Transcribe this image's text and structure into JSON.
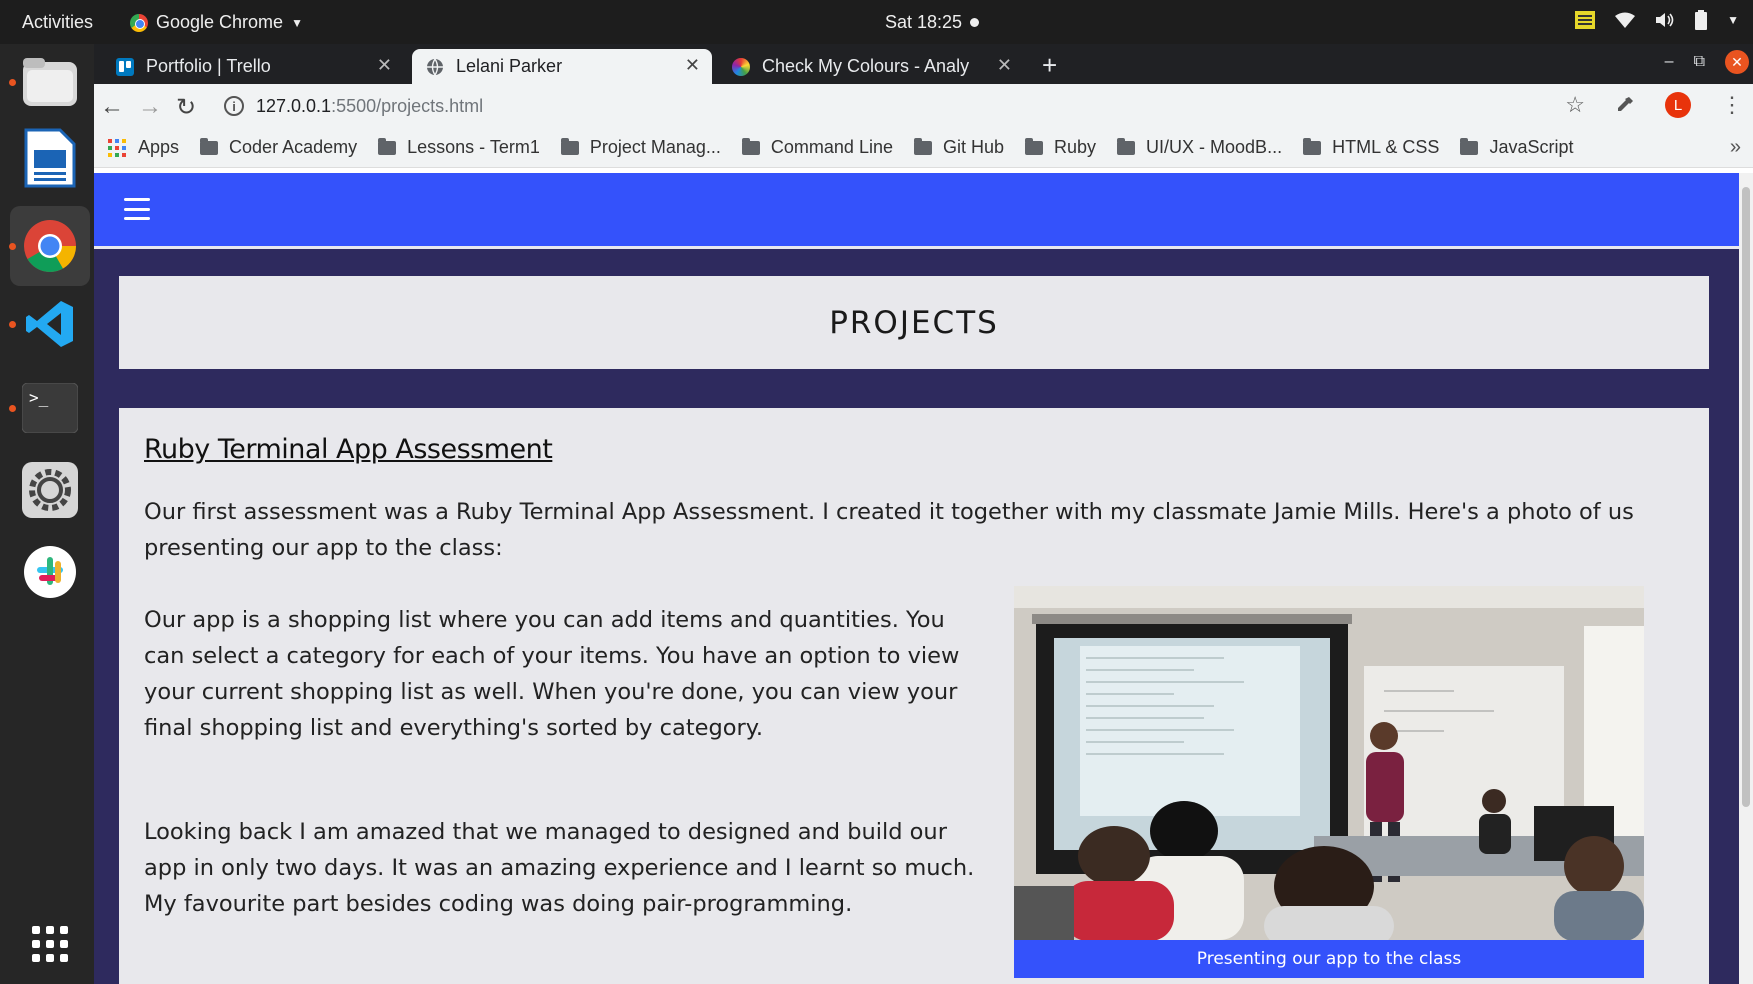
{
  "system": {
    "activities": "Activities",
    "app_name": "Google Chrome",
    "clock": "Sat 18:25"
  },
  "tabs": [
    {
      "title": "Portfolio | Trello",
      "icon": "trello-icon"
    },
    {
      "title": "Lelani Parker",
      "icon": "globe-icon"
    },
    {
      "title": "Check My Colours - Analy",
      "icon": "colour-wheel-icon"
    }
  ],
  "address": {
    "host": "127.0.0.1",
    "path": ":5500/projects.html"
  },
  "bookmarks": [
    "Coder Academy",
    "Lessons - Term1",
    "Project Manag...",
    "Command Line",
    "Git Hub",
    "Ruby",
    "UI/UX - MoodB...",
    "HTML & CSS",
    "JavaScript"
  ],
  "bookmarks_apps": "Apps",
  "profile_initial": "L",
  "page": {
    "heading": "PROJECTS",
    "project": {
      "title": "Ruby Terminal App Assessment",
      "intro": "Our first assessment was a Ruby Terminal App Assessment. I created it together with my classmate Jamie Mills. Here's a photo of us presenting our app to the class:",
      "description": "Our app is a shopping list where you can add items and quantities. You can select a category for each of your items. You have an option to view your current shopping list as well. When you're done, you can view your final shopping list and everything's sorted by category.",
      "reflection": "Looking back I am amazed that we managed to designed and build our app in only two days. It was an amazing experience and I learnt so much. My favourite part besides coding was doing pair-programming.",
      "caption": "Presenting our app to the class"
    }
  },
  "colors": {
    "nav_blue": "#3452fb",
    "page_bg": "#2e2a5e",
    "card_bg": "#e8e8ec",
    "ubuntu_orange": "#e95420"
  }
}
